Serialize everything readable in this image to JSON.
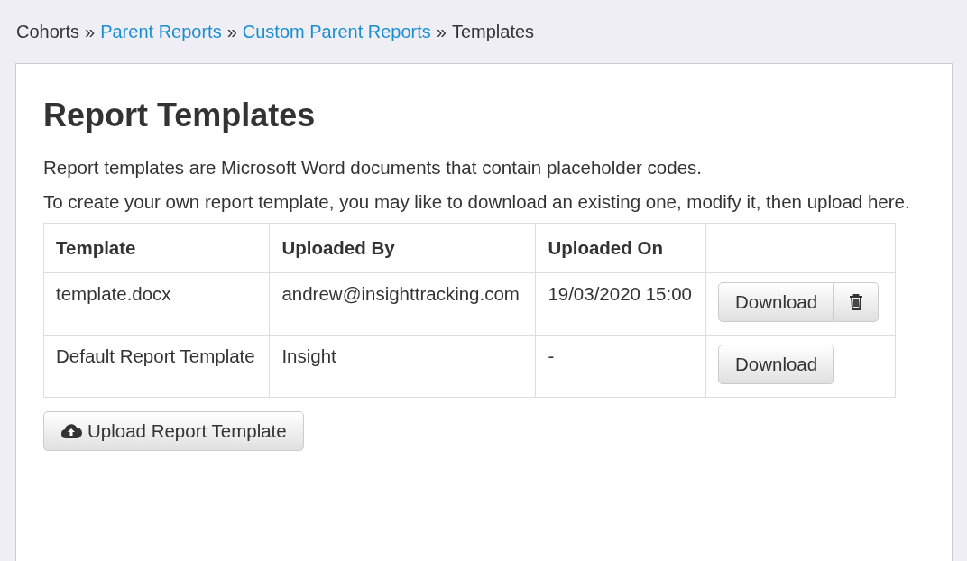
{
  "breadcrumb": [
    {
      "label": "Cohorts",
      "kind": "plain",
      "separator": "»"
    },
    {
      "label": "Parent Reports",
      "kind": "link",
      "separator": "»"
    },
    {
      "label": "Custom Parent Reports",
      "kind": "link",
      "separator": "»"
    },
    {
      "label": "Templates",
      "kind": "plain"
    }
  ],
  "title": "Report Templates",
  "paragraphs": [
    "Report templates are Microsoft Word documents that contain placeholder codes.",
    "To create your own report template, you may like to download an existing one, modify it, then upload here."
  ],
  "table": {
    "columns": [
      "Template",
      "Uploaded By",
      "Uploaded On"
    ],
    "rows": [
      {
        "template": "template.docx",
        "uploaded_by": "andrew@insighttracking.com",
        "uploaded_on": "19/03/2020 15:00",
        "download": "Download",
        "deletable": true
      },
      {
        "template": "Default Report Template",
        "uploaded_by": "Insight",
        "uploaded_on": "-",
        "download": "Download",
        "deletable": false
      }
    ]
  },
  "upload_button": "Upload Report Template"
}
